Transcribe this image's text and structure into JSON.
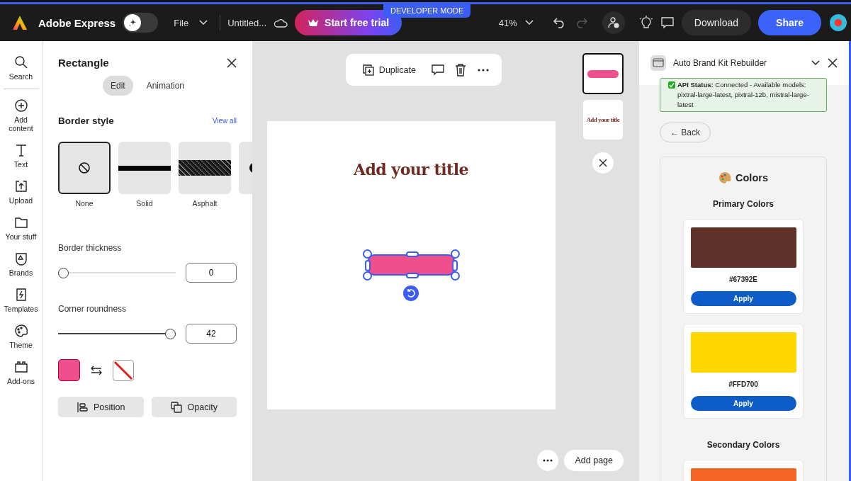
{
  "topbar": {
    "app_name": "Adobe Express",
    "magic_toggle": {
      "on": false
    },
    "file_menu": "File",
    "doc_title": "Untitled...",
    "trial_button": "Start free trial",
    "mode_badge": "DEVELOPER MODE",
    "zoom": "41%",
    "download_button": "Download",
    "share_button": "Share"
  },
  "rail": [
    {
      "label": "Search",
      "kind": "search"
    },
    {
      "label": "Add content",
      "kind": "add"
    },
    {
      "label": "Text",
      "kind": "text"
    },
    {
      "label": "Upload",
      "kind": "upload"
    },
    {
      "label": "Your stuff",
      "kind": "folder"
    },
    {
      "label": "Brands",
      "kind": "brands"
    },
    {
      "label": "Templates",
      "kind": "templates"
    },
    {
      "label": "Theme",
      "kind": "theme"
    },
    {
      "label": "Add-ons",
      "kind": "addons"
    }
  ],
  "panel": {
    "title": "Rectangle",
    "tabs": [
      {
        "label": "Edit",
        "selected": true
      },
      {
        "label": "Animation",
        "selected": false
      }
    ],
    "border_style": {
      "heading": "Border style",
      "link": "View all",
      "styles": [
        {
          "label": "None",
          "kind": "none",
          "selected": true
        },
        {
          "label": "Solid",
          "kind": "solid",
          "selected": false
        },
        {
          "label": "Asphalt",
          "kind": "asphalt",
          "selected": false
        },
        {
          "kind": "blob",
          "selected": false
        }
      ]
    },
    "sliders": [
      {
        "label": "Border thickness",
        "level": 0,
        "value": "0"
      },
      {
        "label": "Corner roundness",
        "level": 1,
        "value": "42"
      }
    ],
    "buttons": [
      {
        "label": "Position",
        "kind": "position"
      },
      {
        "label": "Opacity",
        "kind": "opacity"
      }
    ]
  },
  "canvas": {
    "toolbar": {
      "duplicate": "Duplicate"
    },
    "page_title": "Add your title",
    "thumbnails": [
      {
        "kind": "shape",
        "selected": true
      },
      {
        "kind": "title",
        "label": "Add your title",
        "selected": false
      }
    ],
    "add_page": "Add page"
  },
  "addon": {
    "title": "Auto Brand Kit Rebuilder",
    "status": "**API Status:** Connected - Available models: pixtral-large-latest, pixtral-12b, mistral-large-latest",
    "back": "← Back",
    "section": "Colors",
    "primary_heading": "Primary Colors",
    "primary": [
      {
        "color": "#5e3129",
        "label": "#67392E",
        "button": "Apply"
      },
      {
        "color": "#ffd700",
        "label": "#FFD700",
        "button": "Apply"
      }
    ],
    "secondary_heading": "Secondary Colors",
    "secondary": [
      {
        "color": "#f26522"
      }
    ]
  }
}
